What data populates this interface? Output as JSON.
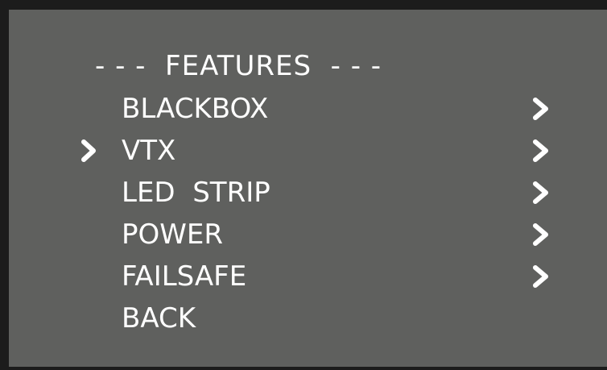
{
  "menu": {
    "title": "- - -  FEATURES  - - -",
    "items": [
      {
        "label": "BLACKBOX",
        "has_submenu": true,
        "selected": false
      },
      {
        "label": "VTX",
        "has_submenu": true,
        "selected": true
      },
      {
        "label": "LED  STRIP",
        "has_submenu": true,
        "selected": false
      },
      {
        "label": "POWER",
        "has_submenu": true,
        "selected": false
      },
      {
        "label": "FAILSAFE",
        "has_submenu": true,
        "selected": false
      },
      {
        "label": "BACK",
        "has_submenu": false,
        "selected": false
      }
    ]
  },
  "icons": {
    "cursor": "chevron-right-icon",
    "submenu": "chevron-right-icon"
  },
  "colors": {
    "background": "#5f605e",
    "border": "#1c1c1c",
    "text": "#ffffff"
  }
}
